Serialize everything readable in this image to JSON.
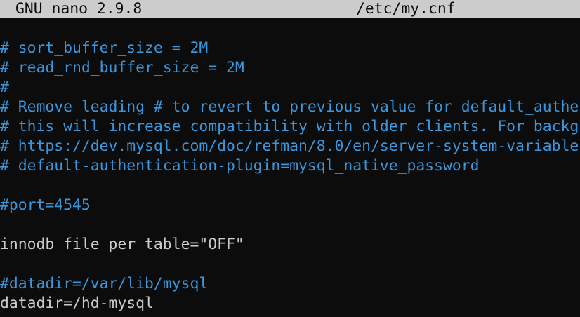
{
  "titlebar": {
    "app": "GNU nano 2.9.8",
    "file": "/etc/my.cnf"
  },
  "colors": {
    "comment": "#3a96dd",
    "text": "#cccccc",
    "background": "#0c0c0c",
    "titlebar": "#cccccc"
  },
  "lines": [
    {
      "text": "",
      "type": "plain"
    },
    {
      "text": "# sort_buffer_size = 2M",
      "type": "comment"
    },
    {
      "text": "# read_rnd_buffer_size = 2M",
      "type": "comment"
    },
    {
      "text": "#",
      "type": "comment"
    },
    {
      "text": "# Remove leading # to revert to previous value for default_authe",
      "type": "comment"
    },
    {
      "text": "# this will increase compatibility with older clients. For backg",
      "type": "comment"
    },
    {
      "text": "# https://dev.mysql.com/doc/refman/8.0/en/server-system-variable",
      "type": "comment"
    },
    {
      "text": "# default-authentication-plugin=mysql_native_password",
      "type": "comment"
    },
    {
      "text": "",
      "type": "plain"
    },
    {
      "text": "#port=4545",
      "type": "comment"
    },
    {
      "text": "",
      "type": "plain"
    },
    {
      "text": "innodb_file_per_table=\"OFF\"",
      "type": "plain"
    },
    {
      "text": "",
      "type": "plain"
    },
    {
      "text": "#datadir=/var/lib/mysql",
      "type": "comment"
    },
    {
      "text": "datadir=/hd-mysql",
      "type": "plain"
    }
  ]
}
